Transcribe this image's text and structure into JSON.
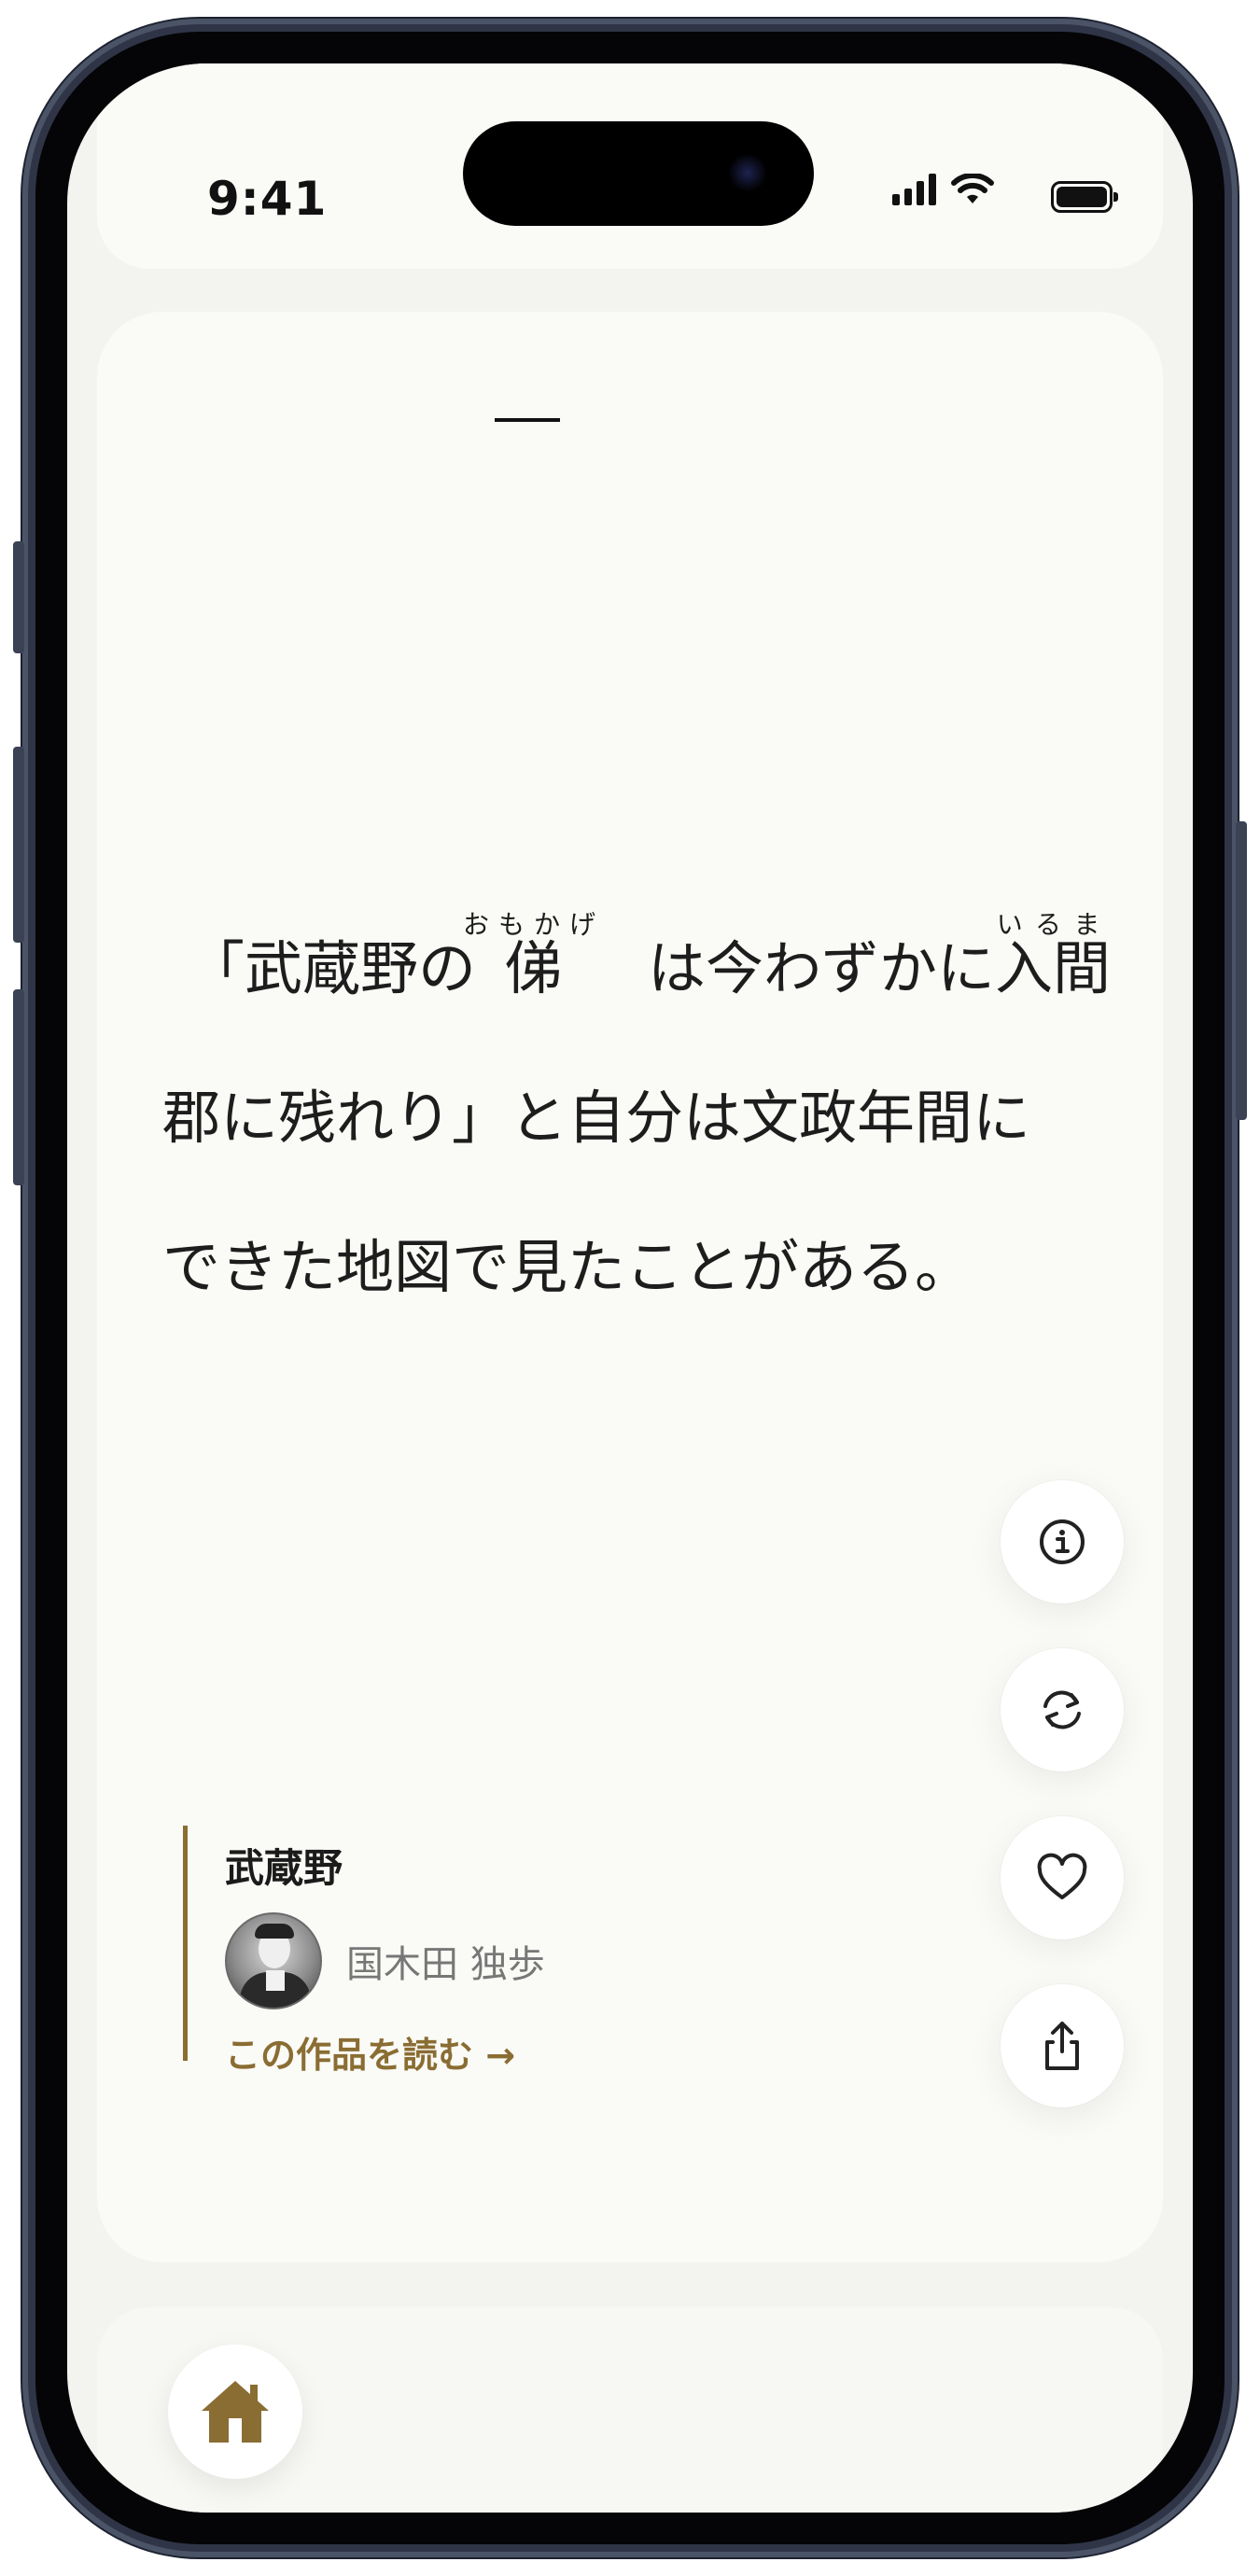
{
  "status_bar": {
    "time": "9:41"
  },
  "reader": {
    "chapter": "一",
    "lines": [
      {
        "before": "「武蔵野の",
        "ruby_base_1": "俤",
        "ruby_text_1": "おもかげ",
        "middle": "は今わずかに",
        "ruby_base_2": "入間",
        "ruby_text_2": "いるま"
      },
      {
        "text": "郡に残れり」と自分は文政年間に"
      },
      {
        "text": "できた地図で見たことがある。"
      }
    ]
  },
  "actions": [
    {
      "icon": "info-icon"
    },
    {
      "icon": "refresh-icon"
    },
    {
      "icon": "heart-icon"
    },
    {
      "icon": "share-icon"
    }
  ],
  "work": {
    "title": "武蔵野",
    "author": "国木田 独歩",
    "read_link": "この作品を読む →"
  },
  "nav": {
    "home_icon": "home-icon"
  },
  "colors": {
    "accent": "#8a6d33",
    "background": "#f3f3ef",
    "card": "#fafaf6"
  }
}
